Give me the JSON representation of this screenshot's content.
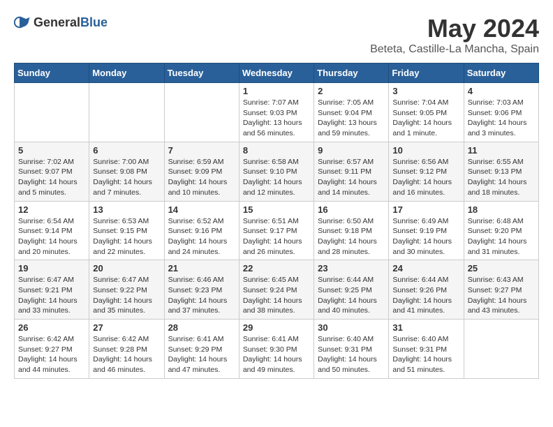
{
  "header": {
    "logo_general": "General",
    "logo_blue": "Blue",
    "month_year": "May 2024",
    "location": "Beteta, Castille-La Mancha, Spain"
  },
  "weekdays": [
    "Sunday",
    "Monday",
    "Tuesday",
    "Wednesday",
    "Thursday",
    "Friday",
    "Saturday"
  ],
  "weeks": [
    [
      {
        "day": "",
        "info": ""
      },
      {
        "day": "",
        "info": ""
      },
      {
        "day": "",
        "info": ""
      },
      {
        "day": "1",
        "info": "Sunrise: 7:07 AM\nSunset: 9:03 PM\nDaylight: 13 hours\nand 56 minutes."
      },
      {
        "day": "2",
        "info": "Sunrise: 7:05 AM\nSunset: 9:04 PM\nDaylight: 13 hours\nand 59 minutes."
      },
      {
        "day": "3",
        "info": "Sunrise: 7:04 AM\nSunset: 9:05 PM\nDaylight: 14 hours\nand 1 minute."
      },
      {
        "day": "4",
        "info": "Sunrise: 7:03 AM\nSunset: 9:06 PM\nDaylight: 14 hours\nand 3 minutes."
      }
    ],
    [
      {
        "day": "5",
        "info": "Sunrise: 7:02 AM\nSunset: 9:07 PM\nDaylight: 14 hours\nand 5 minutes."
      },
      {
        "day": "6",
        "info": "Sunrise: 7:00 AM\nSunset: 9:08 PM\nDaylight: 14 hours\nand 7 minutes."
      },
      {
        "day": "7",
        "info": "Sunrise: 6:59 AM\nSunset: 9:09 PM\nDaylight: 14 hours\nand 10 minutes."
      },
      {
        "day": "8",
        "info": "Sunrise: 6:58 AM\nSunset: 9:10 PM\nDaylight: 14 hours\nand 12 minutes."
      },
      {
        "day": "9",
        "info": "Sunrise: 6:57 AM\nSunset: 9:11 PM\nDaylight: 14 hours\nand 14 minutes."
      },
      {
        "day": "10",
        "info": "Sunrise: 6:56 AM\nSunset: 9:12 PM\nDaylight: 14 hours\nand 16 minutes."
      },
      {
        "day": "11",
        "info": "Sunrise: 6:55 AM\nSunset: 9:13 PM\nDaylight: 14 hours\nand 18 minutes."
      }
    ],
    [
      {
        "day": "12",
        "info": "Sunrise: 6:54 AM\nSunset: 9:14 PM\nDaylight: 14 hours\nand 20 minutes."
      },
      {
        "day": "13",
        "info": "Sunrise: 6:53 AM\nSunset: 9:15 PM\nDaylight: 14 hours\nand 22 minutes."
      },
      {
        "day": "14",
        "info": "Sunrise: 6:52 AM\nSunset: 9:16 PM\nDaylight: 14 hours\nand 24 minutes."
      },
      {
        "day": "15",
        "info": "Sunrise: 6:51 AM\nSunset: 9:17 PM\nDaylight: 14 hours\nand 26 minutes."
      },
      {
        "day": "16",
        "info": "Sunrise: 6:50 AM\nSunset: 9:18 PM\nDaylight: 14 hours\nand 28 minutes."
      },
      {
        "day": "17",
        "info": "Sunrise: 6:49 AM\nSunset: 9:19 PM\nDaylight: 14 hours\nand 30 minutes."
      },
      {
        "day": "18",
        "info": "Sunrise: 6:48 AM\nSunset: 9:20 PM\nDaylight: 14 hours\nand 31 minutes."
      }
    ],
    [
      {
        "day": "19",
        "info": "Sunrise: 6:47 AM\nSunset: 9:21 PM\nDaylight: 14 hours\nand 33 minutes."
      },
      {
        "day": "20",
        "info": "Sunrise: 6:47 AM\nSunset: 9:22 PM\nDaylight: 14 hours\nand 35 minutes."
      },
      {
        "day": "21",
        "info": "Sunrise: 6:46 AM\nSunset: 9:23 PM\nDaylight: 14 hours\nand 37 minutes."
      },
      {
        "day": "22",
        "info": "Sunrise: 6:45 AM\nSunset: 9:24 PM\nDaylight: 14 hours\nand 38 minutes."
      },
      {
        "day": "23",
        "info": "Sunrise: 6:44 AM\nSunset: 9:25 PM\nDaylight: 14 hours\nand 40 minutes."
      },
      {
        "day": "24",
        "info": "Sunrise: 6:44 AM\nSunset: 9:26 PM\nDaylight: 14 hours\nand 41 minutes."
      },
      {
        "day": "25",
        "info": "Sunrise: 6:43 AM\nSunset: 9:27 PM\nDaylight: 14 hours\nand 43 minutes."
      }
    ],
    [
      {
        "day": "26",
        "info": "Sunrise: 6:42 AM\nSunset: 9:27 PM\nDaylight: 14 hours\nand 44 minutes."
      },
      {
        "day": "27",
        "info": "Sunrise: 6:42 AM\nSunset: 9:28 PM\nDaylight: 14 hours\nand 46 minutes."
      },
      {
        "day": "28",
        "info": "Sunrise: 6:41 AM\nSunset: 9:29 PM\nDaylight: 14 hours\nand 47 minutes."
      },
      {
        "day": "29",
        "info": "Sunrise: 6:41 AM\nSunset: 9:30 PM\nDaylight: 14 hours\nand 49 minutes."
      },
      {
        "day": "30",
        "info": "Sunrise: 6:40 AM\nSunset: 9:31 PM\nDaylight: 14 hours\nand 50 minutes."
      },
      {
        "day": "31",
        "info": "Sunrise: 6:40 AM\nSunset: 9:31 PM\nDaylight: 14 hours\nand 51 minutes."
      },
      {
        "day": "",
        "info": ""
      }
    ]
  ]
}
